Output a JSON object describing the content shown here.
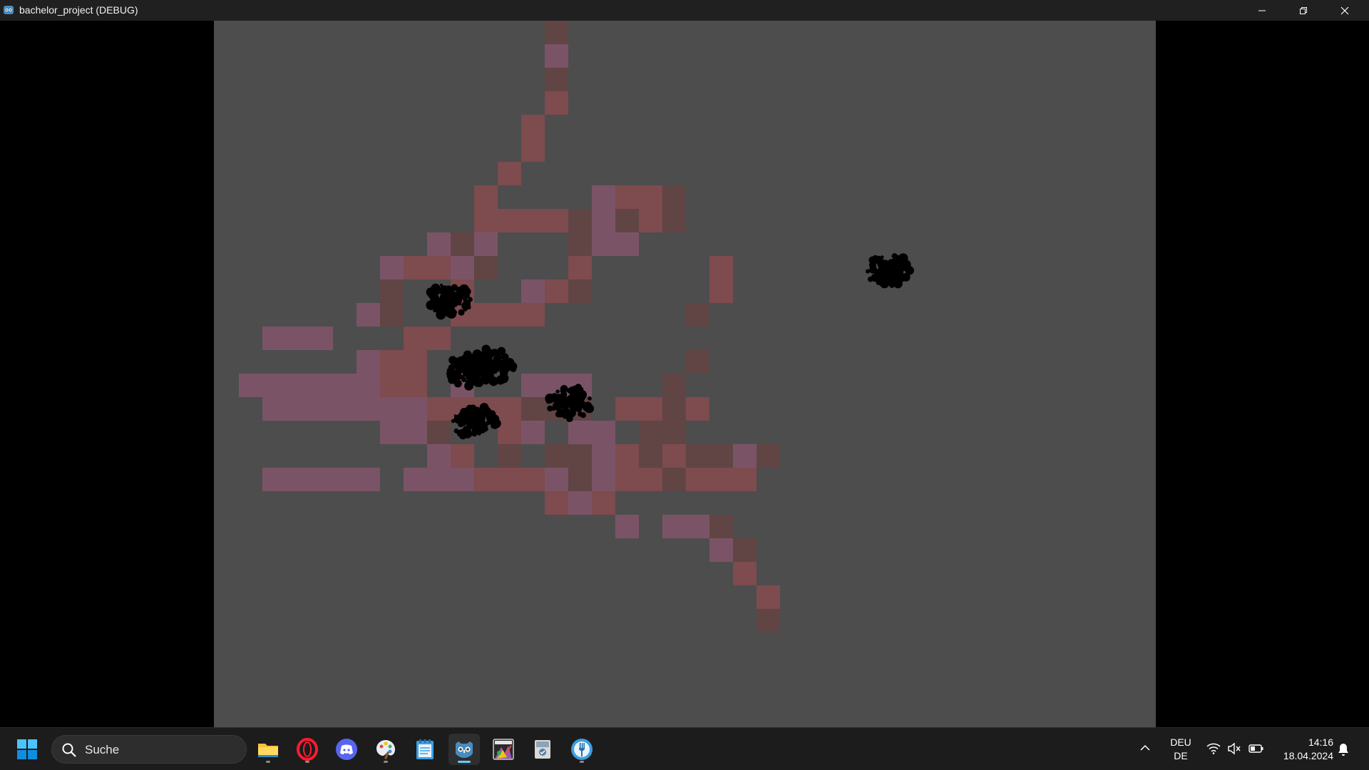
{
  "window": {
    "title": "bachelor_project (DEBUG)",
    "minimize_icon": "minimize-icon",
    "restore_icon": "restore-icon",
    "close_icon": "close-icon"
  },
  "game": {
    "background_color": "#4d4d4d",
    "tile_colors": {
      "purple": "#7a5466",
      "red": "#7e4b4e",
      "brown": "#604544"
    }
  },
  "taskbar": {
    "search_placeholder": "Suche",
    "apps": [
      "file-explorer",
      "opera",
      "discord",
      "paint",
      "notepad",
      "godot",
      "app-7",
      "app-8",
      "app-9"
    ],
    "language_top": "DEU",
    "language_bottom": "DE",
    "time": "14:16",
    "date": "18.04.2024"
  }
}
